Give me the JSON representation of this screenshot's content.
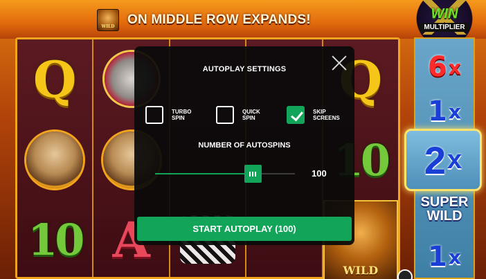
{
  "banner": {
    "icon": "lion-wild-icon",
    "icon_text": "WILD",
    "message": "ON MIDDLE ROW EXPANDS!"
  },
  "multiplier_badge": {
    "win": "WIN",
    "label": "MULTIPLIER"
  },
  "reels": [
    [
      "Q",
      "meerkat",
      "10"
    ],
    [
      "rhino",
      "meerkat",
      "A"
    ],
    [
      "",
      "",
      "zebra"
    ],
    [
      "",
      "",
      ""
    ],
    [
      "Q",
      "10",
      "lion-wild"
    ]
  ],
  "lion_wild_label": "WILD",
  "multiplier_column": {
    "cells": [
      {
        "num": "6",
        "x": "x",
        "color": "#ff2a2a"
      },
      {
        "num": "1",
        "x": "x",
        "color": "#1a3fd6"
      },
      {
        "num": "2",
        "x": "x",
        "color": "#1a3fd6",
        "highlighted": true
      },
      {
        "num": "1",
        "x": "x",
        "color": "#1a3fd6"
      }
    ],
    "super_wild_line1": "SUPER",
    "super_wild_line2": "WILD"
  },
  "modal": {
    "title": "AUTOPLAY SETTINGS",
    "close_icon": "close-icon",
    "options": [
      {
        "label": "TURBO\nSPIN",
        "checked": false
      },
      {
        "label": "QUICK\nSPIN",
        "checked": false
      },
      {
        "label": "SKIP\nSCREENS",
        "checked": true
      }
    ],
    "autospins_label": "NUMBER OF AUTOSPINS",
    "slider_value": "100",
    "slider_fraction": 0.7,
    "start_button": "START AUTOPLAY (100)"
  },
  "colors": {
    "accent_green": "#12a55a",
    "reel_border": "#f0a51c",
    "modal_bg": "#0a0a0a"
  }
}
